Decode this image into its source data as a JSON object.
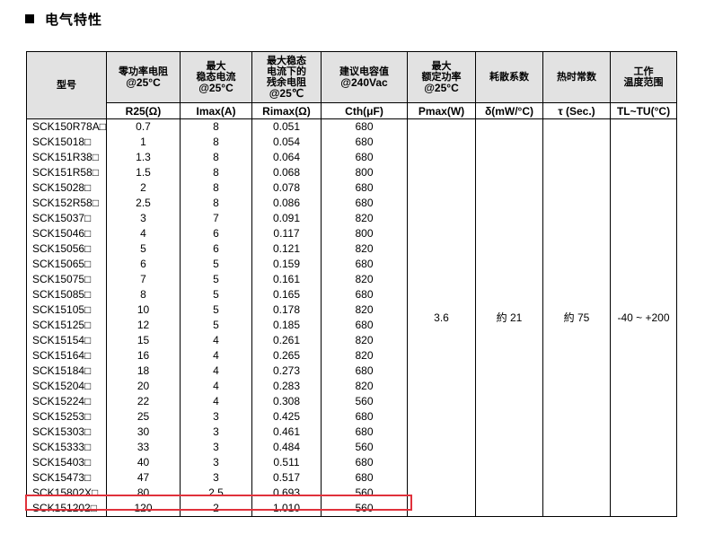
{
  "section": {
    "title": "电气特性"
  },
  "table": {
    "headers": [
      "型号",
      "零功率电阻\n@25°C",
      "最大\n稳态电流\n@25°C",
      "最大稳态\n电流下的\n残余电阻\n@25℃",
      "建议电容值\n@240Vac",
      "最大\n额定功率\n@25°C",
      "耗散系数",
      "热时常数",
      "工作\n温度范围"
    ],
    "units": [
      "",
      "R25(Ω)",
      "Imax(A)",
      "Rimax(Ω)",
      "Cth(μF)",
      "Pmax(W)",
      "δ(mW/°C)",
      "τ (Sec.)",
      "TL~TU(°C)"
    ],
    "rows": [
      [
        "SCK150R78A□",
        "0.7",
        "8",
        "0.051",
        "680"
      ],
      [
        "SCK15018□",
        "1",
        "8",
        "0.054",
        "680"
      ],
      [
        "SCK151R38□",
        "1.3",
        "8",
        "0.064",
        "680"
      ],
      [
        "SCK151R58□",
        "1.5",
        "8",
        "0.068",
        "800"
      ],
      [
        "SCK15028□",
        "2",
        "8",
        "0.078",
        "680"
      ],
      [
        "SCK152R58□",
        "2.5",
        "8",
        "0.086",
        "680"
      ],
      [
        "SCK15037□",
        "3",
        "7",
        "0.091",
        "820"
      ],
      [
        "SCK15046□",
        "4",
        "6",
        "0.117",
        "800"
      ],
      [
        "SCK15056□",
        "5",
        "6",
        "0.121",
        "820"
      ],
      [
        "SCK15065□",
        "6",
        "5",
        "0.159",
        "680"
      ],
      [
        "SCK15075□",
        "7",
        "5",
        "0.161",
        "820"
      ],
      [
        "SCK15085□",
        "8",
        "5",
        "0.165",
        "680"
      ],
      [
        "SCK15105□",
        "10",
        "5",
        "0.178",
        "820"
      ],
      [
        "SCK15125□",
        "12",
        "5",
        "0.185",
        "680"
      ],
      [
        "SCK15154□",
        "15",
        "4",
        "0.261",
        "820"
      ],
      [
        "SCK15164□",
        "16",
        "4",
        "0.265",
        "820"
      ],
      [
        "SCK15184□",
        "18",
        "4",
        "0.273",
        "680"
      ],
      [
        "SCK15204□",
        "20",
        "4",
        "0.283",
        "820"
      ],
      [
        "SCK15224□",
        "22",
        "4",
        "0.308",
        "560"
      ],
      [
        "SCK15253□",
        "25",
        "3",
        "0.425",
        "680"
      ],
      [
        "SCK15303□",
        "30",
        "3",
        "0.461",
        "680"
      ],
      [
        "SCK15333□",
        "33",
        "3",
        "0.484",
        "560"
      ],
      [
        "SCK15403□",
        "40",
        "3",
        "0.511",
        "680"
      ],
      [
        "SCK15473□",
        "47",
        "3",
        "0.517",
        "680"
      ],
      [
        "SCK15802X□",
        "80",
        "2.5",
        "0.693",
        "560"
      ],
      [
        "SCK151202□",
        "120",
        "2",
        "1.010",
        "560"
      ]
    ],
    "shared": {
      "pmax": "3.6",
      "dissipation": "約 21",
      "time_constant": "約 75",
      "temp_range": "-40 ~ +200"
    },
    "highlighted_row": "SCK15473□",
    "highlight_color": "#e0313b",
    "header_bg": "#e2e2e2"
  }
}
